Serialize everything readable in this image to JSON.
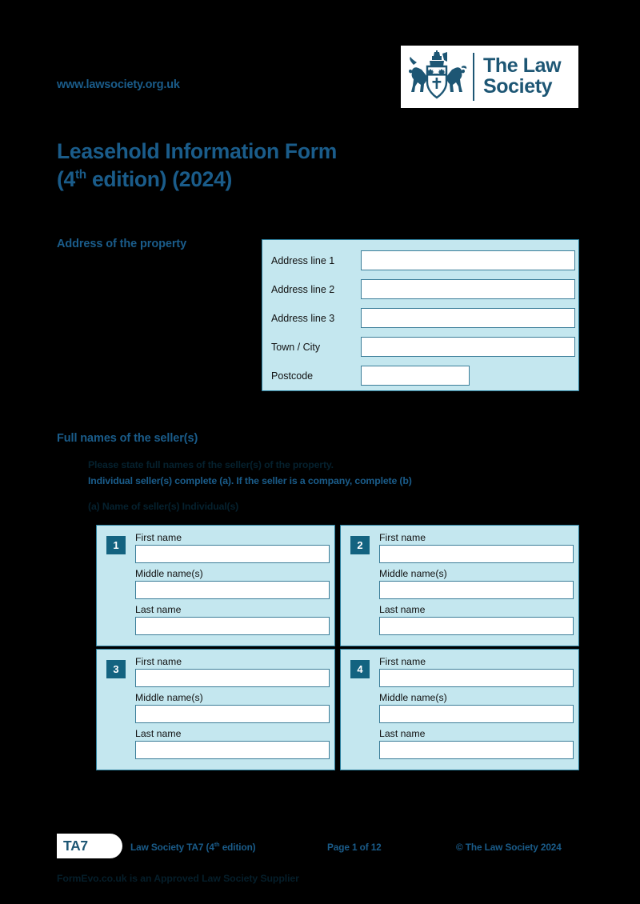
{
  "header": {
    "site_url": "www.lawsociety.org.uk",
    "logo": {
      "icon": "law-society-crest-icon",
      "line1": "The Law",
      "line2": "Society"
    }
  },
  "title": {
    "line1": "Leasehold Information Form",
    "line2_prefix": "(4",
    "line2_sup": "th",
    "line2_suffix": " edition) (2024)"
  },
  "address_section": {
    "heading": "Address of the property",
    "rows": [
      {
        "label": "Address line 1",
        "value": "",
        "width": "wide"
      },
      {
        "label": "Address line 2",
        "value": "",
        "width": "wide"
      },
      {
        "label": "Address line 3",
        "value": "",
        "width": "wide"
      },
      {
        "label": "Town / City",
        "value": "",
        "width": "wide"
      },
      {
        "label": "Postcode",
        "value": "",
        "width": "narrow"
      }
    ]
  },
  "sellers_section": {
    "heading": "Full names of the seller(s)",
    "instruction_1": "Please state full names of the seller(s) of the property.",
    "instruction_2": "Individual seller(s) complete (a). If the seller is a company, complete (b)",
    "instruction_3": "(a) Name of seller(s) Individual(s)",
    "field_labels": {
      "first_name": "First name",
      "middle_names": "Middle name(s)",
      "last_name": "Last name"
    },
    "sellers": [
      {
        "number": "1",
        "first_name": "",
        "middle_names": "",
        "last_name": ""
      },
      {
        "number": "2",
        "first_name": "",
        "middle_names": "",
        "last_name": ""
      },
      {
        "number": "3",
        "first_name": "",
        "middle_names": "",
        "last_name": ""
      },
      {
        "number": "4",
        "first_name": "",
        "middle_names": "",
        "last_name": ""
      }
    ]
  },
  "footer": {
    "badge": "TA7",
    "edition_prefix": "Law Society TA7 (4",
    "edition_sup": "th",
    "edition_suffix": " edition)",
    "page": "Page 1 of 12",
    "copyright": "© The Law Society 2024",
    "supplier": "FormEvo.co.uk is an Approved Law Society Supplier"
  },
  "colors": {
    "brand_blue": "#1a5c8a",
    "logo_navy": "#1d5674",
    "panel_fill": "#c4e7ef",
    "panel_border": "#2b7f9e",
    "badge_teal": "#136380",
    "page_background": "#000000"
  }
}
